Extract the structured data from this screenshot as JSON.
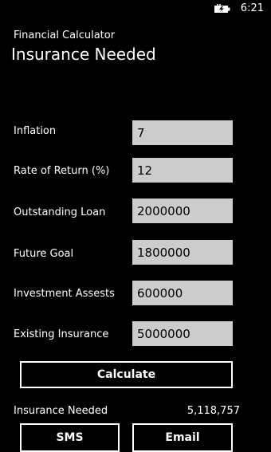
{
  "status_bar": {
    "time": "6:21",
    "battery_icon": "battery-charging-icon"
  },
  "header": {
    "app_title": "Financial Calculator",
    "page_title": "Insurance Needed"
  },
  "form": {
    "fields": [
      {
        "label": "Inflation",
        "value": "7"
      },
      {
        "label": "Rate of Return (%)",
        "value": "12"
      },
      {
        "label": "Outstanding Loan",
        "value": "2000000"
      },
      {
        "label": "Future Goal",
        "value": "1800000"
      },
      {
        "label": "Investment Assests",
        "value": "600000"
      },
      {
        "label": "Existing Insurance",
        "value": "5000000"
      }
    ]
  },
  "actions": {
    "calculate_label": "Calculate",
    "sms_label": "SMS",
    "email_label": "Email"
  },
  "result": {
    "label": "Insurance Needed",
    "value": "5,118,757"
  },
  "colors": {
    "background": "#000000",
    "foreground": "#ffffff",
    "input_background": "#cccccc"
  }
}
